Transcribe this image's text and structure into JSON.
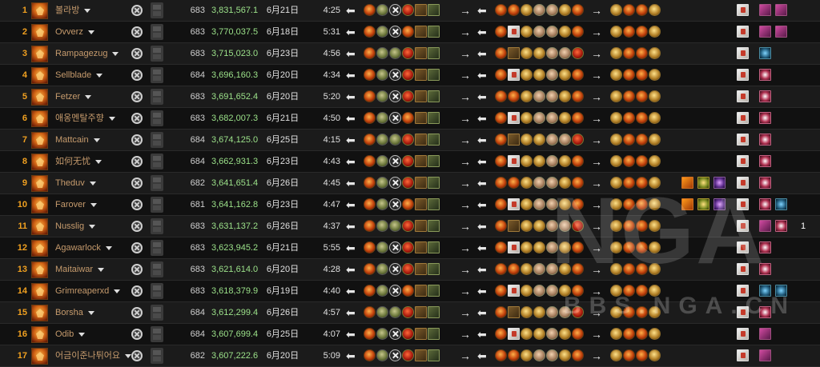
{
  "watermark": {
    "brand": "NGA",
    "domain": "BBS.NGA.CN"
  },
  "arrow_glyph": "⬅",
  "right_arrow_glyph": "→",
  "icon_legend": {
    "spec": "destruction-warlock-icon",
    "log": "combat-log-x-icon",
    "video": "video-icon"
  },
  "rows": [
    {
      "rank": "1",
      "name": "볼라방",
      "ilvl": "683",
      "dps": "3,831,567.1",
      "date": "6月21日",
      "dur": "4:25"
    },
    {
      "rank": "2",
      "name": "Ovverz",
      "ilvl": "683",
      "dps": "3,770,037.5",
      "date": "6月18日",
      "dur": "5:31"
    },
    {
      "rank": "3",
      "name": "Rampagezug",
      "ilvl": "683",
      "dps": "3,715,023.0",
      "date": "6月23日",
      "dur": "4:56"
    },
    {
      "rank": "4",
      "name": "Sellblade",
      "ilvl": "684",
      "dps": "3,696,160.3",
      "date": "6月20日",
      "dur": "4:34"
    },
    {
      "rank": "5",
      "name": "Fetzer",
      "ilvl": "683",
      "dps": "3,691,652.4",
      "date": "6月20日",
      "dur": "5:20"
    },
    {
      "rank": "6",
      "name": "애옹멘탈주향",
      "ilvl": "683",
      "dps": "3,682,007.3",
      "date": "6月21日",
      "dur": "4:50"
    },
    {
      "rank": "7",
      "name": "Mattcain",
      "ilvl": "684",
      "dps": "3,674,125.0",
      "date": "6月25日",
      "dur": "4:15"
    },
    {
      "rank": "8",
      "name": "如何无忧",
      "ilvl": "684",
      "dps": "3,662,931.3",
      "date": "6月23日",
      "dur": "4:43"
    },
    {
      "rank": "9",
      "name": "Theduv",
      "ilvl": "682",
      "dps": "3,641,651.4",
      "date": "6月26日",
      "dur": "4:45"
    },
    {
      "rank": "10",
      "name": "Farover",
      "ilvl": "681",
      "dps": "3,641,162.8",
      "date": "6月23日",
      "dur": "4:47"
    },
    {
      "rank": "11",
      "name": "Nusslig",
      "ilvl": "683",
      "dps": "3,631,137.2",
      "date": "6月26日",
      "dur": "4:37",
      "count": "1"
    },
    {
      "rank": "12",
      "name": "Agawarlock",
      "ilvl": "683",
      "dps": "3,623,945.2",
      "date": "6月21日",
      "dur": "5:55"
    },
    {
      "rank": "13",
      "name": "Maitaiwar",
      "ilvl": "683",
      "dps": "3,621,614.0",
      "date": "6月20日",
      "dur": "4:28"
    },
    {
      "rank": "14",
      "name": "Grimreaperxd",
      "ilvl": "683",
      "dps": "3,618,379.9",
      "date": "6月19日",
      "dur": "4:40"
    },
    {
      "rank": "15",
      "name": "Borsha",
      "ilvl": "684",
      "dps": "3,612,299.4",
      "date": "6月26日",
      "dur": "4:57"
    },
    {
      "rank": "16",
      "name": "Odib",
      "ilvl": "684",
      "dps": "3,607,699.4",
      "date": "6月25日",
      "dur": "4:07"
    },
    {
      "rank": "17",
      "name": "어금이준나튀어요",
      "ilvl": "682",
      "dps": "3,607,222.6",
      "date": "6月20日",
      "dur": "5:09"
    }
  ]
}
